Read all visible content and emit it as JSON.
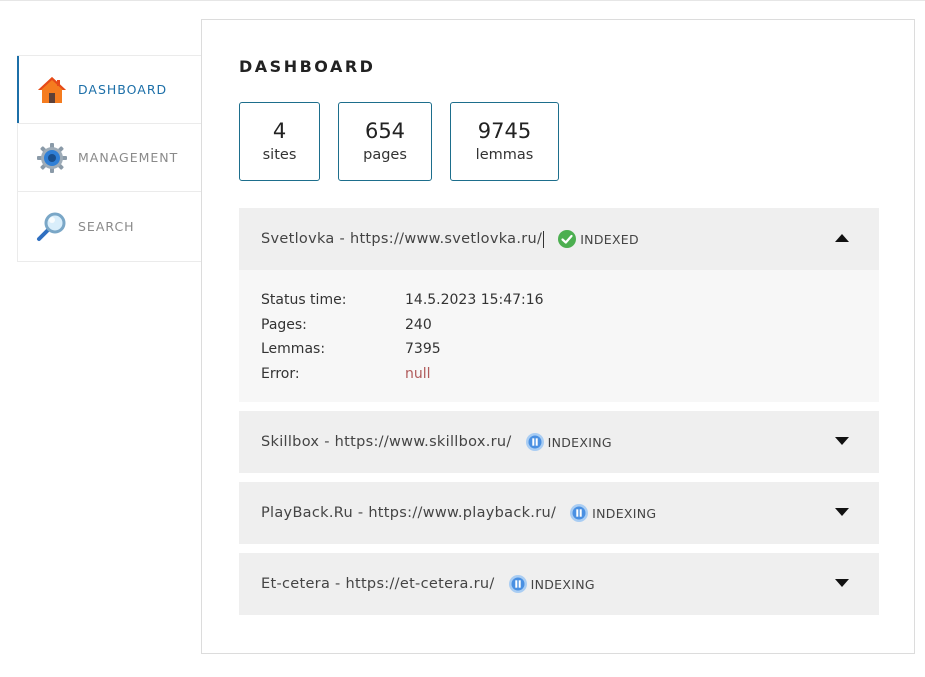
{
  "sidebar": {
    "items": [
      {
        "label": "DASHBOARD",
        "icon": "home-icon",
        "active": true
      },
      {
        "label": "MANAGEMENT",
        "icon": "gear-icon",
        "active": false
      },
      {
        "label": "SEARCH",
        "icon": "search-icon",
        "active": false
      }
    ]
  },
  "main": {
    "title": "DASHBOARD",
    "stats": [
      {
        "value": "4",
        "label": "sites"
      },
      {
        "value": "654",
        "label": "pages"
      },
      {
        "value": "9745",
        "label": "lemmas"
      }
    ],
    "sites": [
      {
        "title": "Svetlovka - https://www.svetlovka.ru/",
        "status": "INDEXED",
        "status_icon": "check-circle-icon",
        "expanded": true,
        "details": [
          {
            "key": "Status time:",
            "value": "14.5.2023 15:47:16"
          },
          {
            "key": "Pages:",
            "value": "240"
          },
          {
            "key": "Lemmas:",
            "value": "7395"
          },
          {
            "key": "Error:",
            "value": "null"
          }
        ]
      },
      {
        "title": "Skillbox - https://www.skillbox.ru/",
        "status": "INDEXING",
        "status_icon": "pause-circle-icon",
        "expanded": false
      },
      {
        "title": "PlayBack.Ru - https://www.playback.ru/",
        "status": "INDEXING",
        "status_icon": "pause-circle-icon",
        "expanded": false
      },
      {
        "title": "Et-cetera - https://et-cetera.ru/",
        "status": "INDEXING",
        "status_icon": "pause-circle-icon",
        "expanded": false
      }
    ]
  },
  "colors": {
    "accent": "#1c6fa8",
    "stat_border": "#1d6e8c",
    "indexed": "#4caf50",
    "indexing": "#4a90e2",
    "error_value": "#b05a5a"
  }
}
